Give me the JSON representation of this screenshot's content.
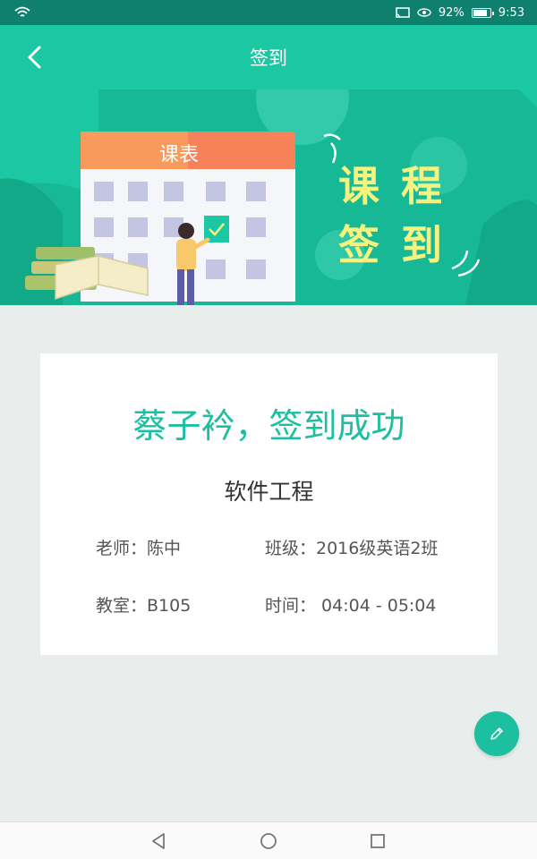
{
  "status_bar": {
    "battery_text": "92%",
    "battery_level": 0.92,
    "time": "9:53",
    "icons": [
      "wifi-icon",
      "cast-icon",
      "eye-icon",
      "battery-icon"
    ]
  },
  "header": {
    "title": "签到",
    "back_icon": "chevron-left-icon"
  },
  "banner": {
    "calendar_title": "课表",
    "chars": [
      "课",
      "程",
      "签",
      "到"
    ]
  },
  "card": {
    "success_text": "蔡子衿，签到成功",
    "course_name": "软件工程",
    "teacher": "老师：陈中",
    "class": "班级：2016级英语2班",
    "room": "教室：B105",
    "time": "时间： 04:04 - 05:04"
  },
  "fab": {
    "icon": "pencil-icon"
  },
  "nav": {
    "icons": [
      "back-triangle-icon",
      "home-circle-icon",
      "recents-square-icon"
    ]
  },
  "colors": {
    "accent": "#1cc7a4",
    "status_bar": "#10806e",
    "success_text": "#1cc0a0",
    "background": "#e9eeed"
  }
}
